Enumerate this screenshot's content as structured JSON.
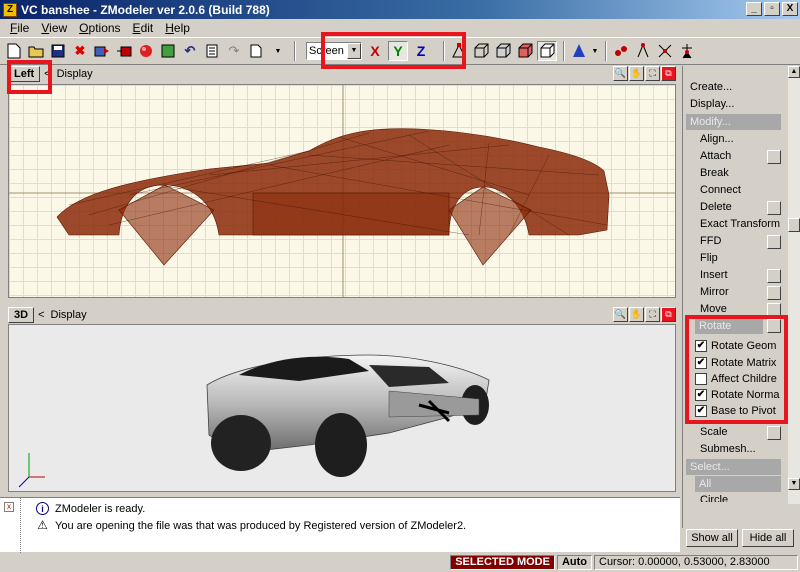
{
  "window": {
    "title": "VC banshee - ZModeler ver 2.0.6 (Build 788)",
    "app_icon": "Z",
    "buttons": [
      "_",
      "▫",
      "X"
    ]
  },
  "menu": [
    {
      "label": "File",
      "u": "F",
      "rest": "ile"
    },
    {
      "label": "View",
      "u": "V",
      "rest": "iew"
    },
    {
      "label": "Options",
      "u": "O",
      "rest": "ptions"
    },
    {
      "label": "Edit",
      "u": "E",
      "rest": "dit"
    },
    {
      "label": "Help",
      "u": "H",
      "rest": "elp"
    }
  ],
  "toolbar": {
    "coord_system": "Screen",
    "axis_x": "X",
    "axis_y": "Y",
    "axis_z": "Z"
  },
  "viewport_top": {
    "tab": "Left",
    "nav": "<",
    "label": "Display"
  },
  "viewport_bottom": {
    "tab": "3D",
    "nav": "<",
    "label": "Display"
  },
  "panel": {
    "create": "Create...",
    "display": "Display...",
    "modify_group": "Modify...",
    "items": [
      "Align...",
      "Attach",
      "Break",
      "Connect",
      "Delete",
      "Exact Transform",
      "FFD",
      "Flip",
      "Insert",
      "Mirror",
      "Move"
    ],
    "rotate_group": "Rotate",
    "rotate_options": [
      {
        "label": "Rotate Geom",
        "checked": true,
        "mark": "✔"
      },
      {
        "label": "Rotate Matrix",
        "checked": true,
        "mark": "✔"
      },
      {
        "label": "Affect Childre",
        "checked": false,
        "mark": ""
      },
      {
        "label": "Rotate Norma",
        "checked": true,
        "mark": "✔"
      },
      {
        "label": "Base to Pivot",
        "checked": true,
        "mark": "✔"
      }
    ],
    "scale": "Scale",
    "submesh": "Submesh...",
    "select_group": "Select...",
    "all_group": "All",
    "circle": "Circle",
    "show_all": "Show all",
    "hide_all": "Hide all"
  },
  "log": [
    {
      "icon": "info-icon",
      "text": "ZModeler is ready."
    },
    {
      "icon": "warning-icon",
      "text": "You are opening the file was that was produced by Registered version of ZModeler2."
    }
  ],
  "status": {
    "mode": "SELECTED MODE",
    "auto": "Auto",
    "cursor": "Cursor: 0.00000, 0.53000, 2.83000"
  }
}
